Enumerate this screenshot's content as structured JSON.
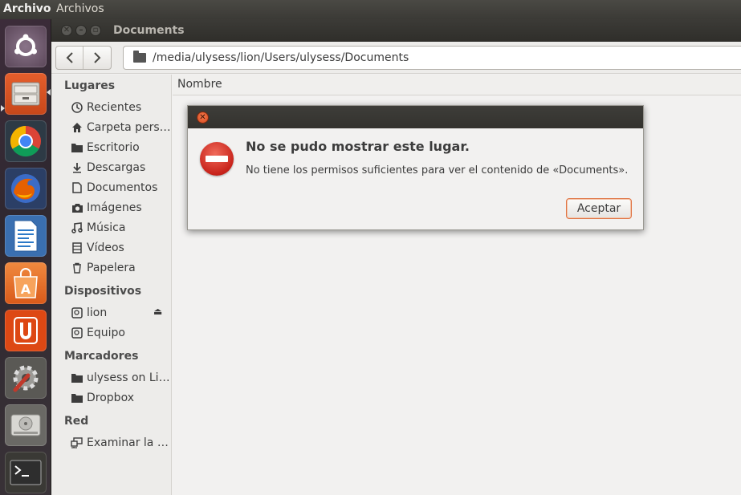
{
  "top_panel": {
    "active_app": "Archivos",
    "menu_label": "Archivos"
  },
  "launcher": {
    "items": [
      {
        "icon": "ubuntu-dash-icon",
        "color": "#6f5a6b"
      },
      {
        "icon": "file-manager-icon",
        "color": "#b9b6b0"
      },
      {
        "icon": "chrome-icon",
        "color": "#3a7bd5"
      },
      {
        "icon": "firefox-icon",
        "color": "#e66000"
      },
      {
        "icon": "libreoffice-writer-icon",
        "color": "#2c79c7"
      },
      {
        "icon": "software-center-icon",
        "color": "#e8682a"
      },
      {
        "icon": "ubuntu-one-icon",
        "color": "#dd4814"
      },
      {
        "icon": "system-settings-icon",
        "color": "#7a7975"
      },
      {
        "icon": "disk-drive-icon",
        "color": "#9a9995"
      },
      {
        "icon": "terminal-icon",
        "color": "#2e2e2e"
      }
    ]
  },
  "window": {
    "title": "Documents",
    "location_path": "/media/ulysess/lion/Users/ulysess/Documents",
    "column_header": "Nombre"
  },
  "sidebar": {
    "lugares_title": "Lugares",
    "lugares": [
      {
        "label": "Recientes",
        "icon": "recent-clock-icon"
      },
      {
        "label": "Carpeta pers…",
        "icon": "home-icon"
      },
      {
        "label": "Escritorio",
        "icon": "desktop-folder-icon"
      },
      {
        "label": "Descargas",
        "icon": "download-icon"
      },
      {
        "label": "Documentos",
        "icon": "document-icon"
      },
      {
        "label": "Imágenes",
        "icon": "camera-icon"
      },
      {
        "label": "Música",
        "icon": "music-icon"
      },
      {
        "label": "Vídeos",
        "icon": "film-icon"
      },
      {
        "label": "Papelera",
        "icon": "trash-icon"
      }
    ],
    "dispositivos_title": "Dispositivos",
    "dispositivos": [
      {
        "label": "lion",
        "icon": "drive-icon"
      },
      {
        "label": "Equipo",
        "icon": "drive-icon"
      }
    ],
    "marcadores_title": "Marcadores",
    "marcadores": [
      {
        "label": "ulysess on Lion",
        "icon": "folder-icon"
      },
      {
        "label": "Dropbox",
        "icon": "folder-icon"
      }
    ],
    "red_title": "Red",
    "red": [
      {
        "label": "Examinar la …",
        "icon": "network-icon"
      }
    ]
  },
  "dialog": {
    "heading": "No se pudo mostrar este lugar.",
    "message": "No tiene los permisos suficientes para ver el contenido de «Documents».",
    "accept_label": "Aceptar",
    "accent_color": "#e07545"
  }
}
